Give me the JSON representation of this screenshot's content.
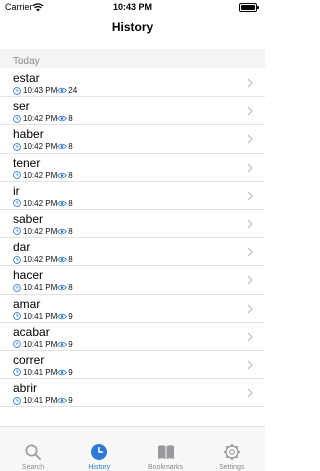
{
  "status_bar": {
    "carrier": "Carrier",
    "time": "10:43 PM"
  },
  "nav": {
    "title": "History"
  },
  "section": {
    "header": "Today"
  },
  "history": [
    {
      "word": "estar",
      "time": "10:43 PM",
      "views": "24"
    },
    {
      "word": "ser",
      "time": "10:42 PM",
      "views": "8"
    },
    {
      "word": "haber",
      "time": "10:42 PM",
      "views": "8"
    },
    {
      "word": "tener",
      "time": "10:42 PM",
      "views": "8"
    },
    {
      "word": "ir",
      "time": "10:42 PM",
      "views": "8"
    },
    {
      "word": "saber",
      "time": "10:42 PM",
      "views": "8"
    },
    {
      "word": "dar",
      "time": "10:42 PM",
      "views": "8"
    },
    {
      "word": "hacer",
      "time": "10:41 PM",
      "views": "8"
    },
    {
      "word": "amar",
      "time": "10:41 PM",
      "views": "9"
    },
    {
      "word": "acabar",
      "time": "10:41 PM",
      "views": "9"
    },
    {
      "word": "correr",
      "time": "10:41 PM",
      "views": "9"
    },
    {
      "word": "abrir",
      "time": "10:41 PM",
      "views": "9"
    }
  ],
  "tabs": [
    {
      "label": "Search",
      "icon": "magnifier-icon",
      "active": false
    },
    {
      "label": "History",
      "icon": "clock-icon",
      "active": true
    },
    {
      "label": "Bookmarks",
      "icon": "book-icon",
      "active": false
    },
    {
      "label": "Settings",
      "icon": "gear-icon",
      "active": false
    }
  ],
  "colors": {
    "accent": "#2f7ad7",
    "inactive": "#8a8a8e",
    "separator": "#e3e3e6"
  }
}
